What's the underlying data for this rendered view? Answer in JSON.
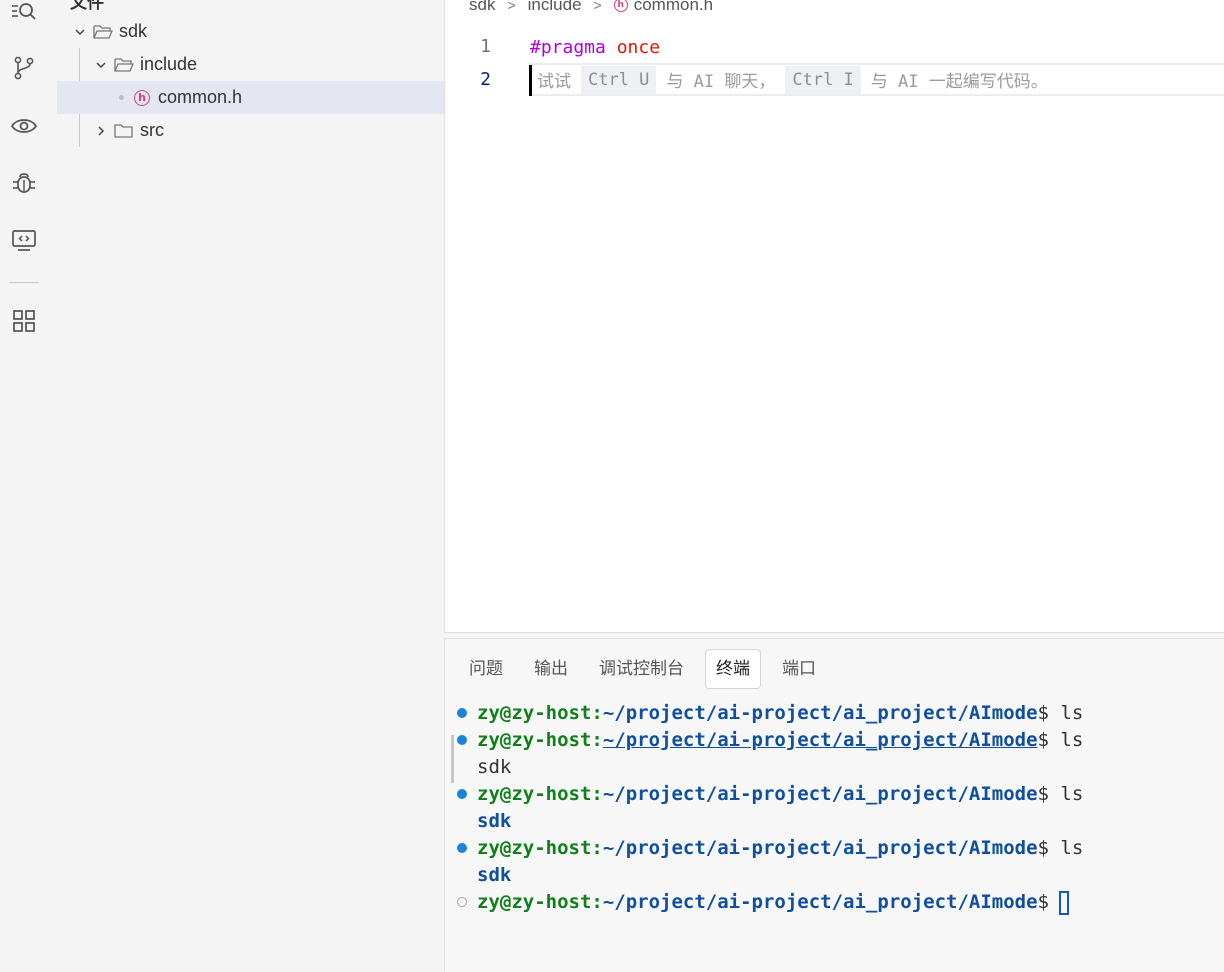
{
  "activity_bar": {
    "icons": [
      "search-icon",
      "source-control-icon",
      "eye-icon",
      "debug-icon",
      "remote-explorer-icon",
      "extensions-icon"
    ]
  },
  "explorer": {
    "title": "文件",
    "tree": {
      "root": "sdk",
      "include": "include",
      "common_file": "common.h",
      "src": "src"
    }
  },
  "editor": {
    "breadcrumb": [
      "sdk",
      "include",
      "common.h"
    ],
    "line_numbers": [
      "1",
      "2"
    ],
    "line1_kw": "#pragma",
    "line1_val": "once",
    "hint": {
      "prefix": "试试",
      "key1": "Ctrl U",
      "mid": "与 AI 聊天，",
      "key2": "Ctrl I",
      "suffix": "与 AI 一起编写代码。"
    }
  },
  "panel": {
    "tabs": [
      "问题",
      "输出",
      "调试控制台",
      "终端",
      "端口"
    ],
    "active_tab": "终端"
  },
  "terminal": {
    "user_host": "zy@zy-host",
    "colon": ":",
    "path": "~/project/ai-project/ai_project/AImode",
    "prompt": "$ ",
    "command": "ls",
    "output_plain": "sdk",
    "output_dir": "sdk"
  },
  "colors": {
    "accent": "#1a85d8",
    "user_green": "#117f1a",
    "path_blue": "#0f4f9e",
    "pragma_purple": "#af00db",
    "once_red": "#e51400",
    "header_icon_pink": "#d63d82"
  }
}
